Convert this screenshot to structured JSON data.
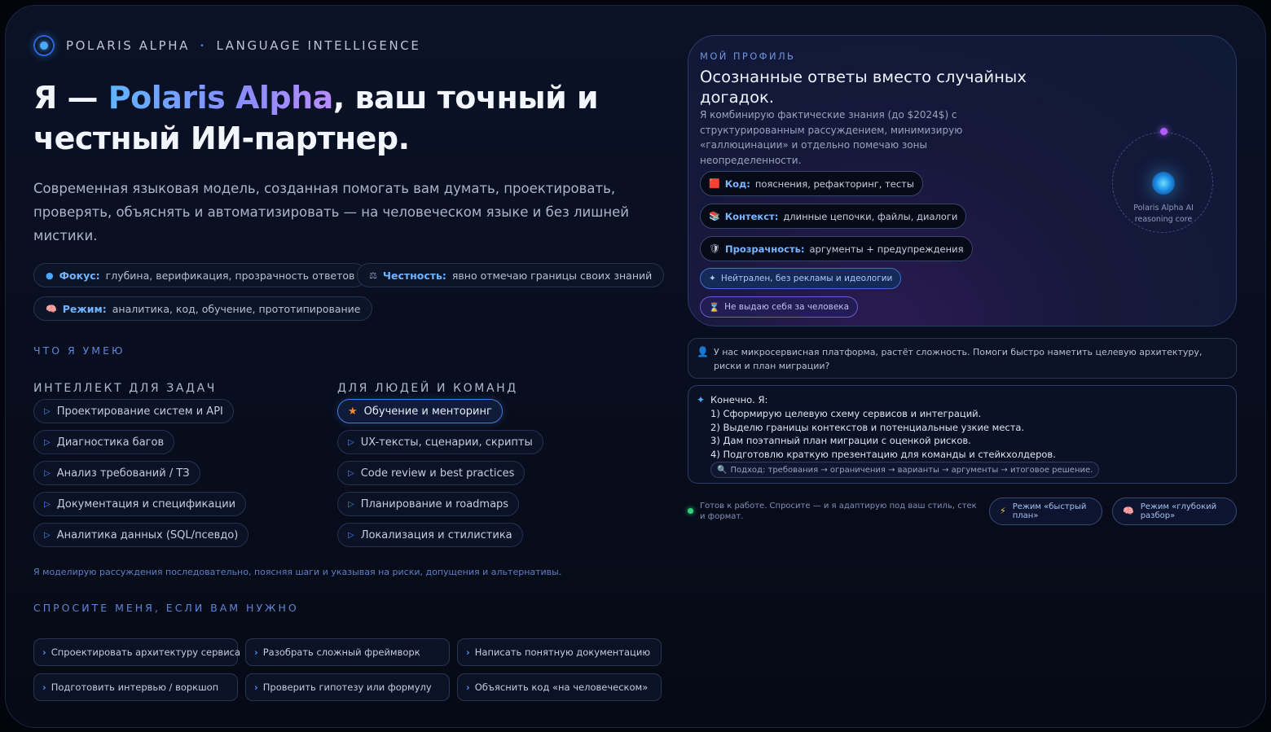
{
  "brand": {
    "name": "POLARIS ALPHA",
    "separator": "•",
    "tagline": "LANGUAGE INTELLIGENCE"
  },
  "hero": {
    "prefix": "Я — ",
    "name": "Polaris Alpha",
    "suffix": ", ваш точный и честный ИИ-партнер.",
    "lead": "Современная языковая модель, созданная помогать вам думать, проектировать, проверять, объяснять и автоматизировать — на человеческом языке и без лишней мистики."
  },
  "pills": [
    {
      "icon": "●",
      "key": "Фокус:",
      "value": "глубина, верификация, прозрачность ответов"
    },
    {
      "icon": "⚖",
      "key": "Честность:",
      "value": "явно отмечаю границы своих знаний"
    },
    {
      "icon": "🧠",
      "key": "Режим:",
      "value": "аналитика, код, обучение, прототипирование"
    }
  ],
  "skills": {
    "label": "ЧТО Я УМЕЮ",
    "left": {
      "heading": "ИНТЕЛЛЕКТ ДЛЯ ЗАДАЧ",
      "items": [
        "Проектирование систем и API",
        "Диагностика багов",
        "Анализ требований / ТЗ",
        "Документация и спецификации",
        "Аналитика данных (SQL/псевдо)"
      ]
    },
    "right": {
      "heading": "ДЛЯ ЛЮДЕЙ И КОМАНД",
      "items": [
        "Обучение и менторинг",
        "UX-тексты, сценарии, скрипты",
        "Code review и best practices",
        "Планирование и roadmaps",
        "Локализация и стилистика"
      ]
    },
    "note": "Я моделирую рассуждения последовательно, поясняя шаги и указывая на риски, допущения и альтернативы."
  },
  "ask": {
    "label": "СПРОСИТЕ МЕНЯ, ЕСЛИ ВАМ НУЖНО",
    "items": [
      "Спроектировать архитектуру сервиса",
      "Разобрать сложный фреймворк",
      "Написать понятную документацию",
      "Подготовить интервью / воркшоп",
      "Проверить гипотезу или формулу",
      "Объяснить код «на человеческом»"
    ]
  },
  "profile": {
    "label": "МОЙ ПРОФИЛЬ",
    "title": "Осознанные ответы вместо случайных догадок.",
    "description": "Я комбинирую фактические знания (до $2024$) с структурированным рассуждением, минимизирую «галлюцинации» и отдельно помечаю зоны неопределенности.",
    "tags": [
      {
        "icon": "🟥",
        "key": "Код:",
        "value": "пояснения, рефакторинг, тесты"
      },
      {
        "icon": "📚",
        "key": "Контекст:",
        "value": "длинные цепочки, файлы, диалоги"
      },
      {
        "icon": "🛡",
        "key": "Прозрачность:",
        "value": "аргументы + предупреждения"
      }
    ],
    "chips": [
      {
        "icon": "✦",
        "text": "Нейтрален, без рекламы и идеологии"
      },
      {
        "icon": "⌛",
        "text": "Не выдаю себя за человека"
      }
    ],
    "orbit_caption": "Polaris Alpha AI reasoning core"
  },
  "chat": {
    "user": "У нас микросервисная платформа, растёт сложность. Помоги быстро наметить целевую архитектуру, риски и план миграции?",
    "ai_lines": [
      "Конечно. Я:",
      "1) Сформирую целевую схему сервисов и интеграций.",
      "2) Выделю границы контекстов и потенциальные узкие места.",
      "3) Дам поэтапный план миграции с оценкой рисков.",
      "4) Подготовлю краткую презентацию для команды и стейкхолдеров."
    ],
    "approach": "Подход: требования → ограничения → варианты → аргументы → итоговое решение."
  },
  "status": {
    "text": "Готов к работе. Спросите — и я адаптирую под ваш стиль, стек и формат.",
    "modes": [
      {
        "icon": "⚡",
        "label": "Режим «быстрый план»"
      },
      {
        "icon": "🧠",
        "label": "Режим «глубокий разбор»"
      }
    ]
  }
}
